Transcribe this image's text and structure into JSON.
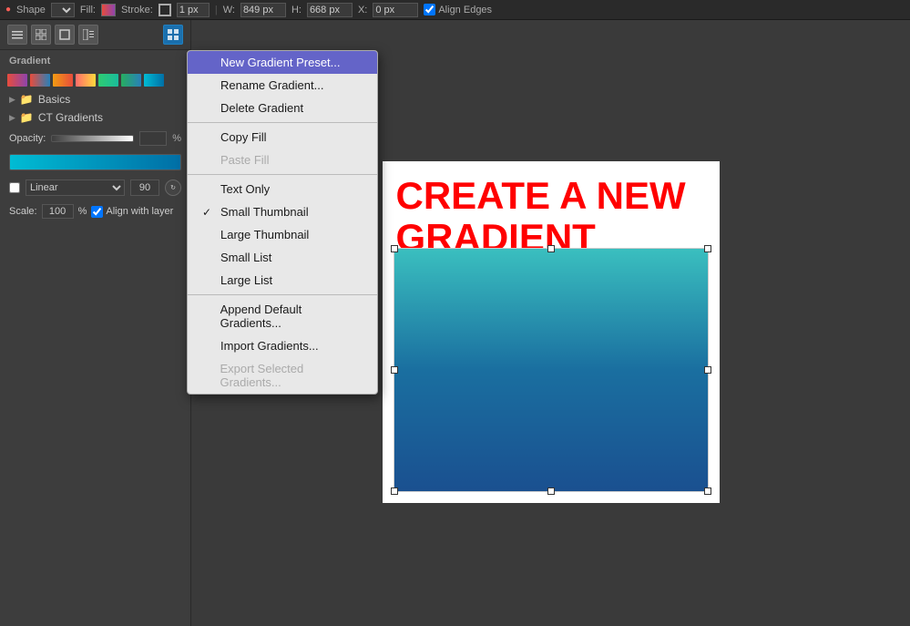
{
  "toolbar": {
    "shape_label": "Shape",
    "fill_label": "Fill:",
    "stroke_label": "Stroke:",
    "stroke_width": "1 px",
    "w_label": "W:",
    "w_value": "849 px",
    "h_label": "H:",
    "h_value": "668 px",
    "x_label": "X:",
    "x_value": "0 px",
    "align_edges_label": "Align Edges"
  },
  "panel": {
    "title": "Gradient",
    "opacity_label": "Opacity:",
    "opacity_value": "",
    "pct": "%",
    "type_label": "Linear",
    "angle_value": "90",
    "scale_label": "Scale:",
    "scale_value": "100",
    "scale_pct": "%",
    "align_with_layer_label": "Align with layer",
    "folders": [
      {
        "name": "Basics"
      },
      {
        "name": "CT Gradients"
      }
    ],
    "swatches": [
      {
        "color": "linear-gradient(to right, #e74c3c, #8e44ad)"
      },
      {
        "color": "linear-gradient(to right, #e74c3c, #2980b9)"
      },
      {
        "color": "linear-gradient(to right, #2ecc71, #1abc9c)"
      },
      {
        "color": "linear-gradient(to right, #27ae60, #2980b9)"
      },
      {
        "color": "linear-gradient(to right, #3498db, #2c3e50)"
      },
      {
        "color": "linear-gradient(to right, #00bcd4, #006fa6)"
      },
      {
        "color": "linear-gradient(to right, #9b59b6, #2980b9)"
      }
    ]
  },
  "menu": {
    "items": [
      {
        "id": "new-gradient-preset",
        "label": "New Gradient Preset...",
        "highlighted": true,
        "disabled": false,
        "checked": false
      },
      {
        "id": "rename-gradient",
        "label": "Rename Gradient...",
        "highlighted": false,
        "disabled": false,
        "checked": false
      },
      {
        "id": "delete-gradient",
        "label": "Delete Gradient",
        "highlighted": false,
        "disabled": false,
        "checked": false
      },
      {
        "id": "divider1",
        "type": "divider"
      },
      {
        "id": "copy-fill",
        "label": "Copy Fill",
        "highlighted": false,
        "disabled": false,
        "checked": false
      },
      {
        "id": "paste-fill",
        "label": "Paste Fill",
        "highlighted": false,
        "disabled": true,
        "checked": false
      },
      {
        "id": "divider2",
        "type": "divider"
      },
      {
        "id": "text-only",
        "label": "Text Only",
        "highlighted": false,
        "disabled": false,
        "checked": false
      },
      {
        "id": "small-thumbnail",
        "label": "Small Thumbnail",
        "highlighted": false,
        "disabled": false,
        "checked": true
      },
      {
        "id": "large-thumbnail",
        "label": "Large Thumbnail",
        "highlighted": false,
        "disabled": false,
        "checked": false
      },
      {
        "id": "small-list",
        "label": "Small List",
        "highlighted": false,
        "disabled": false,
        "checked": false
      },
      {
        "id": "large-list",
        "label": "Large List",
        "highlighted": false,
        "disabled": false,
        "checked": false
      },
      {
        "id": "divider3",
        "type": "divider"
      },
      {
        "id": "append-default",
        "label": "Append Default Gradients...",
        "highlighted": false,
        "disabled": false,
        "checked": false
      },
      {
        "id": "import-gradients",
        "label": "Import Gradients...",
        "highlighted": false,
        "disabled": false,
        "checked": false
      },
      {
        "id": "export-selected",
        "label": "Export Selected Gradients...",
        "highlighted": false,
        "disabled": true,
        "checked": false
      }
    ]
  },
  "canvas": {
    "headline_line1": "CREATE A NEW",
    "headline_line2": "GRADIENT"
  },
  "view_icons": {
    "icon1": "≡≡",
    "icon2": "⊞",
    "icon3": "▣",
    "icon4": "⊟",
    "selected_icon": "▦"
  }
}
